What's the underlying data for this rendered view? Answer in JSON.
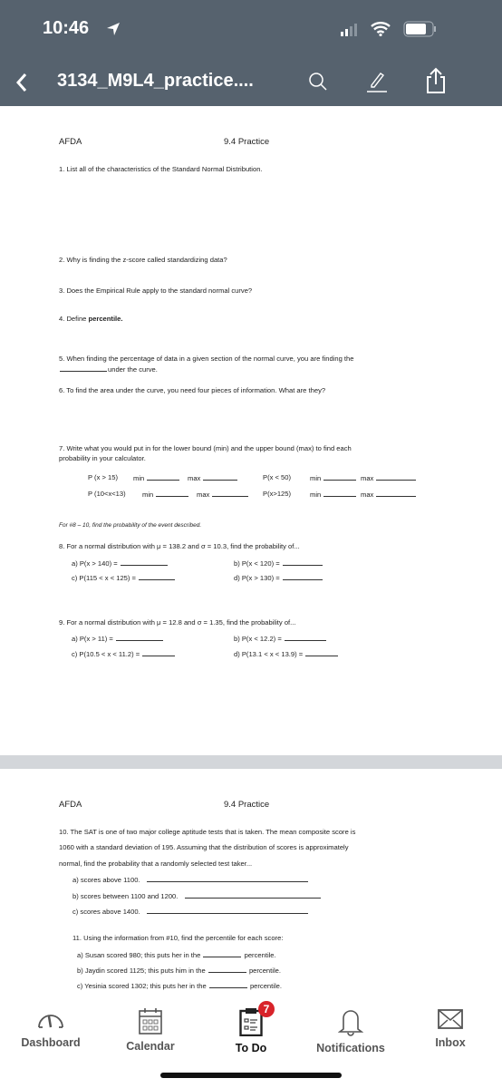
{
  "status": {
    "time": "10:46"
  },
  "nav": {
    "title": "3134_M9L4_practice...."
  },
  "colors": {
    "header": "#56626e",
    "badge": "#d8232a",
    "gap": "#d3d6da"
  },
  "page1": {
    "left_header": "AFDA",
    "right_header": "9.4 Practice",
    "q1": "1. List all of the characteristics of the Standard Normal Distribution.",
    "q2": "2. Why is finding the z-score called standardizing data?",
    "q3": "3. Does the Empirical Rule apply to the standard normal curve?",
    "q4": "4. Define ",
    "q4_bold": "percentile.",
    "q5_line1": "5. When finding the percentage of data in a given section of the normal curve, you are finding the",
    "q5_line2": "under the curve.",
    "q6": "6. To find the area under the curve, you need four pieces of information. What are they?",
    "q7_line1": "7. Write what you would put in for the lower bound (min) and the upper bound (max) to find each",
    "q7_line2": "probability in your calculator.",
    "q7_items": [
      {
        "expr": "P (x > 15)"
      },
      {
        "expr": "P(x < 50)"
      },
      {
        "expr": "P (10<x<13)"
      },
      {
        "expr": "P(x>125)"
      }
    ],
    "min_label": "min",
    "max_label": "max",
    "instructions": "For #8 – 10, find the probability of the event described.",
    "q8": "8. For a normal distribution with μ = 138.2 and σ = 10.3, find the probability of...",
    "q8_parts": [
      "a) P(x > 140) =",
      "b) P(x < 120) =",
      "c) P(115 < x < 125) =",
      "d) P(x > 130) ="
    ],
    "q9": "9. For a normal distribution with μ = 12.8 and σ = 1.35, find the probability of...",
    "q9_parts": [
      "a) P(x > 11) =",
      "b) P(x < 12.2) =",
      "c) P(10.5 < x < 11.2) =",
      "d) P(13.1 < x < 13.9) ="
    ]
  },
  "page2": {
    "left_header": "AFDA",
    "right_header": "9.4 Practice",
    "q10_lines": [
      "10. The SAT is one of two major college aptitude tests that is taken. The mean composite score is",
      "1060 with a standard deviation of 195. Assuming that the distribution of scores is approximately",
      "normal, find the probability that a randomly selected test taker..."
    ],
    "q10_parts": [
      "a) scores above 1100.",
      "b) scores between 1100 and 1200.",
      "c) scores above 1400."
    ],
    "q11": "11. Using the information from #10, find the percentile for each score:",
    "q11_parts": [
      "a) Susan scored 980; this puts her in the",
      "b) Jaydin scored 1125; this puts him in the",
      "c) Yesinia scored 1302; this puts her in the"
    ],
    "percentile": "percentile."
  },
  "tabs": [
    {
      "label": "Dashboard",
      "icon": "gauge-icon"
    },
    {
      "label": "Calendar",
      "icon": "calendar-icon"
    },
    {
      "label": "To Do",
      "icon": "clipboard-icon",
      "badge": "7",
      "active": true
    },
    {
      "label": "Notifications",
      "icon": "bell-icon"
    },
    {
      "label": "Inbox",
      "icon": "envelope-icon"
    }
  ]
}
